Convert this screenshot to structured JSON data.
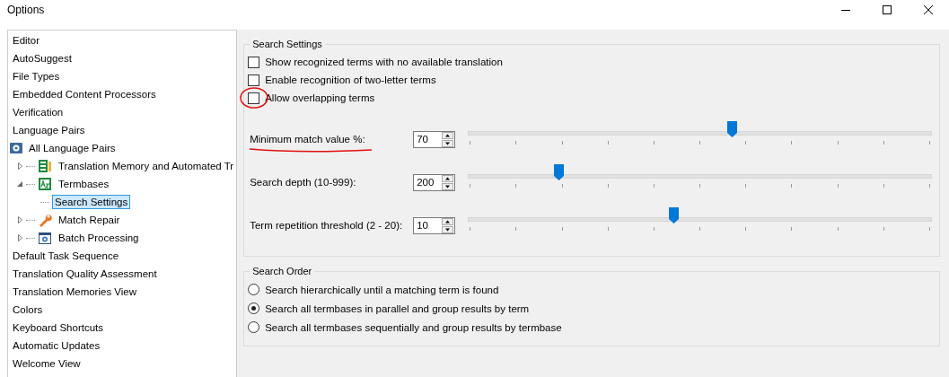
{
  "window": {
    "title": "Options"
  },
  "sidebar": {
    "items": [
      {
        "label": "Editor",
        "selected": false
      },
      {
        "label": "AutoSuggest",
        "selected": false
      },
      {
        "label": "File Types",
        "selected": false
      },
      {
        "label": "Embedded Content Processors",
        "selected": false
      },
      {
        "label": "Verification",
        "selected": false
      },
      {
        "label": "Language Pairs",
        "selected": false
      },
      {
        "label": "All Language Pairs",
        "selected": false,
        "children": [
          {
            "label": "Translation Memory and Automated Tr",
            "selected": false,
            "expanded": false
          },
          {
            "label": "Termbases",
            "selected": false,
            "expanded": true,
            "children": [
              {
                "label": "Search Settings",
                "selected": true
              }
            ]
          },
          {
            "label": "Match Repair",
            "selected": false,
            "expanded": false
          },
          {
            "label": "Batch Processing",
            "selected": false,
            "expanded": false
          }
        ]
      },
      {
        "label": "Default Task Sequence",
        "selected": false
      },
      {
        "label": "Translation Quality Assessment",
        "selected": false
      },
      {
        "label": "Translation Memories View",
        "selected": false
      },
      {
        "label": "Colors",
        "selected": false
      },
      {
        "label": "Keyboard Shortcuts",
        "selected": false
      },
      {
        "label": "Automatic Updates",
        "selected": false
      },
      {
        "label": "Welcome View",
        "selected": false
      }
    ]
  },
  "search_settings": {
    "title": "Search Settings",
    "checkboxes": [
      {
        "label": "Show recognized terms with no available translation",
        "checked": false
      },
      {
        "label": "Enable recognition of two-letter terms",
        "checked": false
      },
      {
        "label": "Allow overlapping terms",
        "checked": false
      }
    ],
    "sliders": [
      {
        "label": "Minimum match value %:",
        "value": "70",
        "level": 0.57
      },
      {
        "label": "Search depth (10-999):",
        "value": "200",
        "level": 0.197
      },
      {
        "label": "Term repetition threshold (2 - 20):",
        "value": "10",
        "level": 0.445
      }
    ]
  },
  "search_order": {
    "title": "Search Order",
    "options": [
      {
        "label": "Search hierarchically until a matching term is found",
        "selected": false
      },
      {
        "label": "Search all termbases in parallel and group results by term",
        "selected": true
      },
      {
        "label": "Search all termbases sequentially and group results by termbase",
        "selected": false
      }
    ]
  }
}
